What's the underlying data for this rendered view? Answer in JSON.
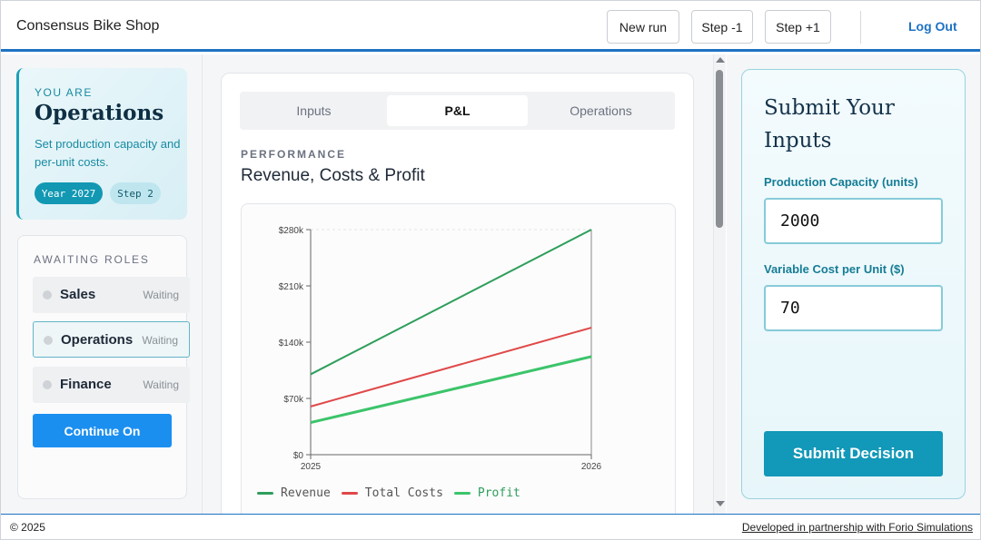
{
  "header": {
    "title": "Consensus Bike Shop",
    "buttons": {
      "new_run": "New run",
      "step_back": "Step -1",
      "step_forward": "Step +1"
    },
    "logout": "Log Out"
  },
  "role": {
    "eyebrow": "YOU ARE",
    "name": "Operations",
    "description": "Set production capacity and per-unit costs.",
    "year_pill": "Year 2027",
    "step_pill": "Step 2"
  },
  "awaiting": {
    "title": "AWAITING ROLES",
    "roles": [
      {
        "name": "Sales",
        "status": "Waiting"
      },
      {
        "name": "Operations",
        "status": "Waiting"
      },
      {
        "name": "Finance",
        "status": "Waiting"
      }
    ],
    "continue_label": "Continue On"
  },
  "main": {
    "tabs": [
      "Inputs",
      "P&L",
      "Operations"
    ],
    "active_tab": "P&L",
    "section_label": "PERFORMANCE",
    "section_title": "Revenue, Costs & Profit"
  },
  "chart_data": {
    "type": "line",
    "x": [
      "2025",
      "2026"
    ],
    "ylim": [
      0,
      280000
    ],
    "yticks": [
      {
        "value": 0,
        "label": "$0"
      },
      {
        "value": 70000,
        "label": "$70k"
      },
      {
        "value": 140000,
        "label": "$140k"
      },
      {
        "value": 210000,
        "label": "$210k"
      },
      {
        "value": 280000,
        "label": "$280k"
      }
    ],
    "series": [
      {
        "name": "Revenue",
        "values": [
          100000,
          280000
        ],
        "color": "#2e9e5b"
      },
      {
        "name": "Total Costs",
        "values": [
          60000,
          158000
        ],
        "color": "#e04848"
      },
      {
        "name": "Profit",
        "values": [
          40000,
          122000
        ],
        "color": "#3cc46a"
      }
    ],
    "legend_position": "bottom-left"
  },
  "submit": {
    "title": "Submit Your Inputs",
    "capacity_label": "Production Capacity (units)",
    "capacity_value": "2000",
    "variable_cost_label": "Variable Cost per Unit ($)",
    "variable_cost_value": "70",
    "button_label": "Submit Decision"
  },
  "footer": {
    "copyright": "© 2025",
    "partner_link": "Developed in partnership with Forio Simulations"
  }
}
